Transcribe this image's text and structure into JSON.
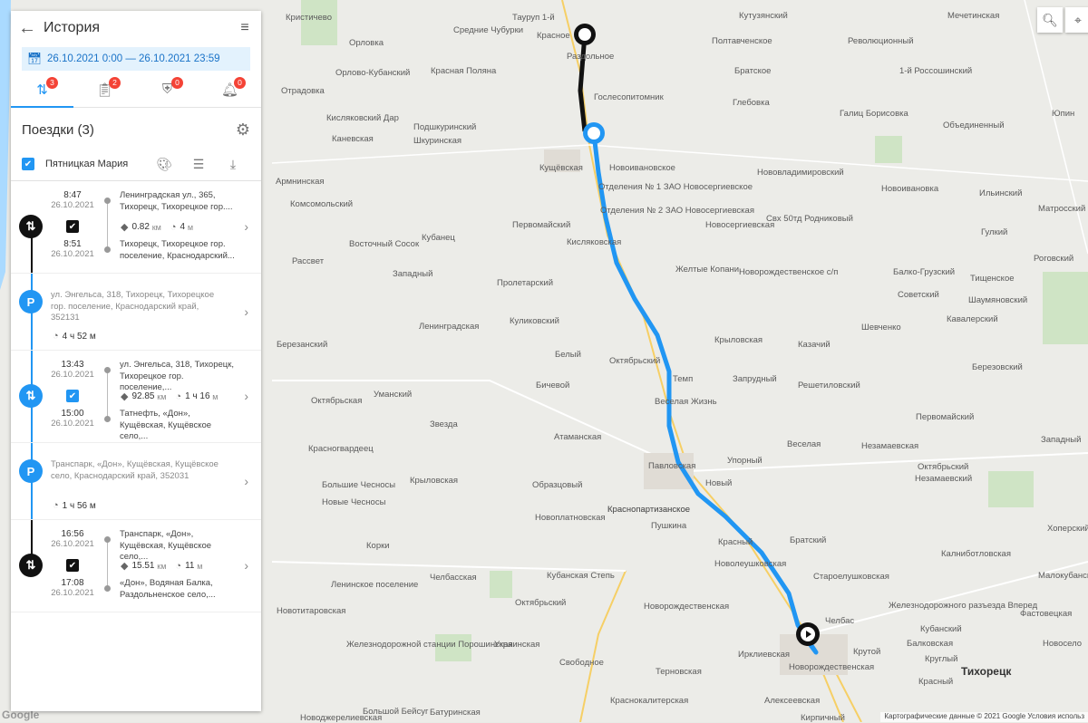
{
  "header": {
    "title": "История"
  },
  "date_range": "26.10.2021 0:00 — 26.10.2021 23:59",
  "tabs": [
    {
      "icon": "route-icon",
      "count": "3"
    },
    {
      "icon": "clipboard-icon",
      "count": "2"
    },
    {
      "icon": "shield-check-icon",
      "count": "0"
    },
    {
      "icon": "bell-icon",
      "count": "0"
    }
  ],
  "section": {
    "title": "Поездки (3)"
  },
  "person": {
    "name": "Пятницкая Мария"
  },
  "items": [
    {
      "type": "trip",
      "start_time": "8:47",
      "start_date": "26.10.2021",
      "end_time": "8:51",
      "end_date": "26.10.2021",
      "from": "Ленинградская ул., 365, Тихорецк, Тихорецкое гор....",
      "to": "Тихорецк, Тихорецкое гор. поселение, Краснодарский...",
      "distance": "0.82",
      "distance_unit": "км",
      "duration": "4",
      "duration_unit": "м"
    },
    {
      "type": "parking",
      "address": "ул. Энгельса, 318, Тихорецк, Тихорецкое гор. поселение, Краснодарский край, 352131",
      "duration": "4 ч 52 м"
    },
    {
      "type": "trip",
      "start_time": "13:43",
      "start_date": "26.10.2021",
      "end_time": "15:00",
      "end_date": "26.10.2021",
      "from": "ул. Энгельса, 318, Тихорецк, Тихорецкое гор. поселение,...",
      "to": "Татнефть, «Дон», Кущёвская, Кущёвское село,...",
      "distance": "92.85",
      "distance_unit": "км",
      "duration": "1 ч 16",
      "duration_unit": "м"
    },
    {
      "type": "parking",
      "address": "Транспарк, «Дон», Кущёвская, Кущёвское село, Краснодарский край, 352031",
      "duration": "1 ч 56 м"
    },
    {
      "type": "trip",
      "start_time": "16:56",
      "start_date": "26.10.2021",
      "end_time": "17:08",
      "end_date": "26.10.2021",
      "from": "Транспарк, «Дон», Кущёвская, Кущёвское село,...",
      "to": "«Дон», Водяная Балка, Раздольненское село,...",
      "distance": "15.51",
      "distance_unit": "км",
      "duration": "11",
      "duration_unit": "м"
    }
  ],
  "map": {
    "footer": "Картографические данные © 2021 Google   Условия использ",
    "logo": "Google",
    "labels": [
      "Кристичево",
      "Тауруп 1-й",
      "Средние Чубурки",
      "Красное",
      "Кутузянский",
      "Мечетинская",
      "Орловка",
      "Раздольное",
      "Полтавченское",
      "Революционный",
      "Братское",
      "1-й Россошинский",
      "Орлово-Кубанский",
      "Красная Поляна",
      "Гослесопитомник",
      "Глебовка",
      "Отрадовка",
      "Кисляковский Дар",
      "Подшкуринский",
      "Шкуринская",
      "Галиц Борисовка",
      "Объединенный",
      "Юпин",
      "Каневская",
      "Кущёвская",
      "Новоивановское",
      "Нововладимировский",
      "Новоивановка",
      "Армнинская",
      "Отделения № 1 ЗАО Новосергиевское",
      "Ильинский",
      "Комсомольский",
      "Отделения № 2 ЗАО Новосергиевская",
      "Новосергиевская",
      "Свх 50тд Родниковый",
      "Матросский",
      "Первомайский",
      "Кубанец",
      "Кисляковская",
      "Гулкий",
      "Восточный Сосок",
      "Рассвет",
      "Желтые Копани",
      "Балко-Грузский",
      "Роговский",
      "Западный",
      "Пролетарский",
      "Новорождественское с/п",
      "Советский",
      "Тищенское",
      "Шаумяновский",
      "Ленинградская",
      "Куликовский",
      "Шевченко",
      "Кавалерский",
      "Березанский",
      "Белый",
      "Октябрьский",
      "Крыловская",
      "Казачий",
      "Березовский",
      "Темп",
      "Запрудный",
      "Решетиловский",
      "Октябрьская",
      "Уманский",
      "Бичевой",
      "Веселая Жизнь",
      "Первомайский",
      "Атаманская",
      "Звезда",
      "Веселая",
      "Незамаевская",
      "Западный",
      "Красногвардеец",
      "Павловская",
      "Упорный",
      "Октябрьский",
      "Новый",
      "Незамаевский",
      "Крыловская",
      "Большие Чесносы",
      "Образцовый",
      "Новоплатновская",
      "Пушкина",
      "Красный",
      "Краснопартизанское",
      "Новые Чесносы",
      "Краснопартизанское",
      "Братский",
      "Хоперский",
      "Калниботловская",
      "Корки",
      "Новолеушковская",
      "Малокубанский",
      "Челбасская",
      "Староелушковская",
      "Ленинское поселение",
      "Кубанская Степь",
      "Октябрьский",
      "Челбас",
      "Фастовецкая",
      "Кубанский",
      "Железнодорожного разъезда Вперед",
      "Новорождественская",
      "Украинская",
      "Новосело",
      "Круглый",
      "Крутой",
      "Железнодорожной станции Порошинская",
      "Свободное",
      "Ирклиевская",
      "Новорождественская",
      "Тихорецк",
      "Терновская",
      "Красный",
      "Кирпичный",
      "Алексеевская",
      "Краснокалитерская",
      "Балковская",
      "Новоджерелиевская",
      "Батуринская",
      "Большой Бейсуг",
      "Новотитаровская"
    ]
  }
}
